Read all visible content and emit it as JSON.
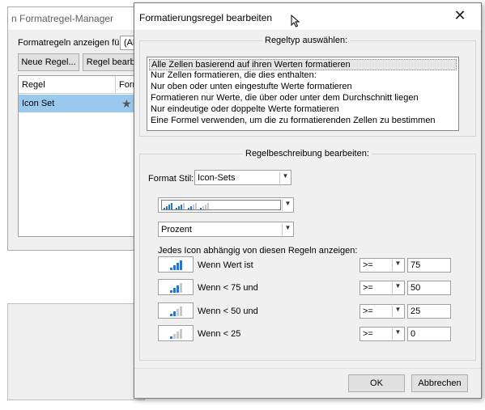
{
  "background_window": {
    "title": "n Formatregel-Manager",
    "show_rules_label": "Formatregeln anzeigen für:",
    "show_rules_value": "(Al",
    "new_rule_label": "Neue Regel...",
    "edit_rule_label": "Regel bearbei",
    "col_rule": "Regel",
    "col_format": "Form",
    "row_rule": "Icon Set"
  },
  "dialog": {
    "title": "Formatierungsregel bearbeiten",
    "close_glyph": "✕",
    "rule_type_group": "Regeltyp auswählen:",
    "rule_types": [
      {
        "label": "Alle Zellen basierend auf ihren Werten formatieren",
        "selected": true
      },
      {
        "label": "Nur Zellen formatieren, die dies enthalten:",
        "selected": false
      },
      {
        "label": "Nur oben oder unten eingestufte Werte formatieren",
        "selected": false
      },
      {
        "label": "Formatieren nur Werte, die über oder unter dem Durchschnitt liegen",
        "selected": false
      },
      {
        "label": "Nur eindeutige oder doppelte Werte formatieren",
        "selected": false
      },
      {
        "label": "Eine Formel verwenden, um die zu formatierenden Zellen zu bestimmen",
        "selected": false
      }
    ],
    "rule_desc_group": "Regelbeschreibung bearbeiten:",
    "format_style_label": "Format Stil:",
    "format_style_value": "Icon-Sets",
    "icon_style": "signal-bars-icon-set",
    "type_value": "Prozent",
    "show_icons_label": "Jedes Icon abhängig von diesen Regeln anzeigen:",
    "rules": [
      {
        "label": "Wenn Wert ist",
        "operator": ">=",
        "value": "75",
        "icon": "signal-4-bars-icon",
        "level": 4
      },
      {
        "label": "Wenn < 75 und",
        "operator": ">=",
        "value": "50",
        "icon": "signal-3-bars-icon",
        "level": 3
      },
      {
        "label": "Wenn < 50 und",
        "operator": ">=",
        "value": "25",
        "icon": "signal-2-bars-icon",
        "level": 2
      },
      {
        "label": "Wenn < 25",
        "operator": ">=",
        "value": "0",
        "icon": "signal-1-bar-icon",
        "level": 1
      }
    ],
    "ok_label": "OK",
    "cancel_label": "Abbrechen"
  },
  "colors": {
    "accent_blue": "#1e78d4",
    "inactive_bar": "#c8c8c8",
    "selection_bg": "#99c9ef"
  }
}
